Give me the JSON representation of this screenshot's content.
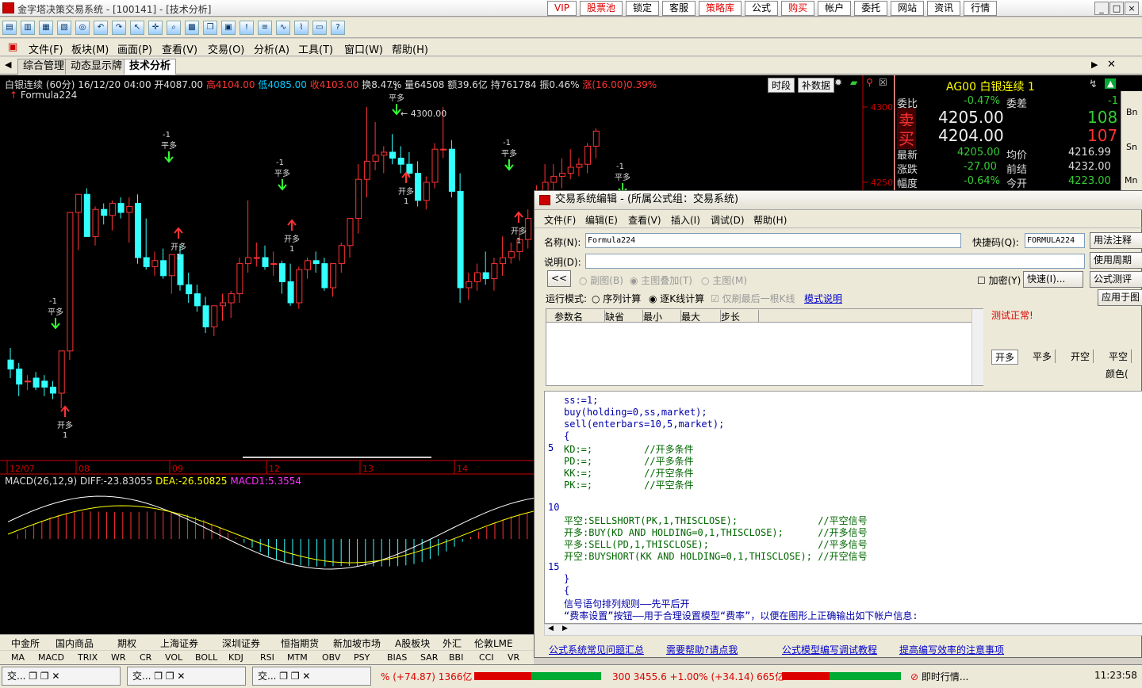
{
  "window": {
    "title": "金字塔决策交易系统 - [100141] - [技术分析]"
  },
  "top_nav": [
    {
      "label": "VIP",
      "red": true
    },
    {
      "label": "股票池",
      "red": true
    },
    {
      "label": "锁定",
      "red": false
    },
    {
      "label": "客服",
      "red": false
    },
    {
      "label": "策略库",
      "red": true
    },
    {
      "label": "公式",
      "red": false
    },
    {
      "label": "购买",
      "red": true
    },
    {
      "label": "帐户",
      "red": false
    },
    {
      "label": "委托",
      "red": false
    },
    {
      "label": "网站",
      "red": false
    },
    {
      "label": "资讯",
      "red": false
    },
    {
      "label": "行情",
      "red": false
    }
  ],
  "menu": [
    "文件(F)",
    "板块(M)",
    "画面(P)",
    "查看(V)",
    "交易(O)",
    "分析(A)",
    "工具(T)",
    "窗口(W)",
    "帮助(H)"
  ],
  "tabs": [
    {
      "label": "综合管理",
      "active": false
    },
    {
      "label": "动态显示牌",
      "active": false
    },
    {
      "label": "技术分析",
      "active": true
    }
  ],
  "chart_header": {
    "name": "白银连续 (60分)",
    "date": "16/12/20 04:00",
    "open": "开4087.00",
    "high": "高4104.00",
    "low": "低4085.00",
    "close": "收4103.00",
    "turnover": "换8.47%",
    "volume": "量64508",
    "amount": "额39.6亿",
    "hold": "持761784",
    "amplitude": "振0.46%",
    "change": "涨(16.00)0.39%",
    "formula": "Formula224",
    "btn_period": "时段",
    "btn_data": "补数据"
  },
  "macd_header": {
    "name": "MACD(26,12,9)",
    "diff": "DIFF:-23.83055",
    "dea": "DEA:-26.50825",
    "macd": "MACD1:5.3554"
  },
  "chart_data": {
    "type": "candlestick",
    "x_labels": [
      "12/07",
      "08",
      "09",
      "12",
      "13",
      "14"
    ],
    "y_ticks": [
      4300,
      4250
    ],
    "max_label": "4300.00",
    "signals": {
      "open_long": "开多",
      "close_long": "平多",
      "qty_pos": "1",
      "qty_neg": "-1"
    }
  },
  "quote": {
    "code": "AG00",
    "name": "白银连续",
    "n": "1",
    "weibi_l": "委比",
    "weibi": "-0.47%",
    "weicha_l": "委差",
    "weicha": "-1",
    "sell_l": "卖",
    "sell_p": "4205.00",
    "sell_v": "108",
    "buy_l": "买",
    "buy_p": "4204.00",
    "buy_v": "107",
    "last_l": "最新",
    "last": "4205.00",
    "avg_l": "均价",
    "avg": "4216.99",
    "chg_l": "涨跌",
    "chg": "-27.00",
    "pre_l": "前结",
    "pre": "4232.00",
    "amp_l": "幅度",
    "amp": "-0.64%",
    "open_l": "今开",
    "open": "4223.00",
    "side": [
      "Bn",
      "Sn",
      "Mn"
    ]
  },
  "editor": {
    "title": "交易系统编辑 - (所属公式组：交易系统)",
    "menu": [
      "文件(F)",
      "编辑(E)",
      "查看(V)",
      "插入(I)",
      "调试(D)",
      "帮助(H)"
    ],
    "name_label": "名称(N):",
    "name_value": "Formula224",
    "hotkey_label": "快捷码(Q):",
    "hotkey_value": "FORMULA224",
    "desc_label": "说明(D):",
    "btn_usage": "用法注释",
    "btn_period": "使用周期",
    "btn_test": "公式测评",
    "btn_apply": "应用于图",
    "btn_back": "<<",
    "opt_sub": "副图(B)",
    "opt_overlay": "主图叠加(T)",
    "opt_main": "主图(M)",
    "chk_encrypt": "加密(Y)",
    "btn_quick": "快速(I)...",
    "mode_label": "运行模式:",
    "mode_seq": "序列计算",
    "mode_bar": "逐K线计算",
    "mode_last": "仅刷最后一根K线",
    "mode_link": "模式说明",
    "param_cols": [
      "参数名",
      "缺省",
      "最小",
      "最大",
      "步长"
    ],
    "test_status": "测试正常!",
    "sig_tabs": [
      "开多",
      "平多",
      "开空",
      "平空"
    ],
    "color_label": "颜色(",
    "code_lines": [
      {
        "n": "",
        "t": "ss:=1;"
      },
      {
        "n": "",
        "t": "buy(holding=0,ss,market);"
      },
      {
        "n": "",
        "t": "sell(enterbars=10,5,market);"
      },
      {
        "n": "",
        "t": "{"
      },
      {
        "n": "5",
        "t": "KD:=;         //开多条件"
      },
      {
        "n": "",
        "t": "PD:=;         //平多条件"
      },
      {
        "n": "",
        "t": "KK:=;         //开空条件"
      },
      {
        "n": "",
        "t": "PK:=;         //平空条件"
      },
      {
        "n": "",
        "t": ""
      },
      {
        "n": "10",
        "t": ""
      },
      {
        "n": "",
        "t": "平空:SELLSHORT(PK,1,THISCLOSE);              //平空信号"
      },
      {
        "n": "",
        "t": "开多:BUY(KD AND HOLDING=0,1,THISCLOSE);      //开多信号"
      },
      {
        "n": "",
        "t": "平多:SELL(PD,1,THISCLOSE);                   //平多信号"
      },
      {
        "n": "",
        "t": "开空:BUYSHORT(KK AND HOLDING=0,1,THISCLOSE); //开空信号"
      },
      {
        "n": "15",
        "t": ""
      },
      {
        "n": "",
        "t": "}"
      },
      {
        "n": "",
        "t": "{"
      },
      {
        "n": "",
        "t": "信号语句排列规则——先平后开"
      },
      {
        "n": "",
        "t": "“费率设置”按钮——用于合理设置模型“费率”，以便在图形上正确输出如下帐户信息:"
      }
    ],
    "links": [
      "公式系统常见问题汇总",
      "需要帮助?请点我",
      "公式模型编写调试教程",
      "提高编写效率的注意事项"
    ]
  },
  "bottom_tabs": [
    "中金所",
    "国内商品",
    "期权",
    "上海证券",
    "深圳证券",
    "恒指期货",
    "新加坡市场",
    "A股板块",
    "外汇",
    "伦敦LME"
  ],
  "indicator_tabs": [
    "MA",
    "MACD",
    "TRIX",
    "WR",
    "CR",
    "VOL",
    "BOLL",
    "KDJ",
    "RSI",
    "MTM",
    "OBV",
    "PSY",
    "BIAS",
    "SAR",
    "BBI",
    "CCI",
    "VR"
  ],
  "taskbar": {
    "items": [
      "交...",
      "交...",
      "交..."
    ],
    "ticker1": "% (+74.87) 1366亿",
    "ticker2": "300 3455.6 +1.00% (+34.14) 665亿",
    "app": "即时行情...",
    "clock": "11:23:58"
  }
}
